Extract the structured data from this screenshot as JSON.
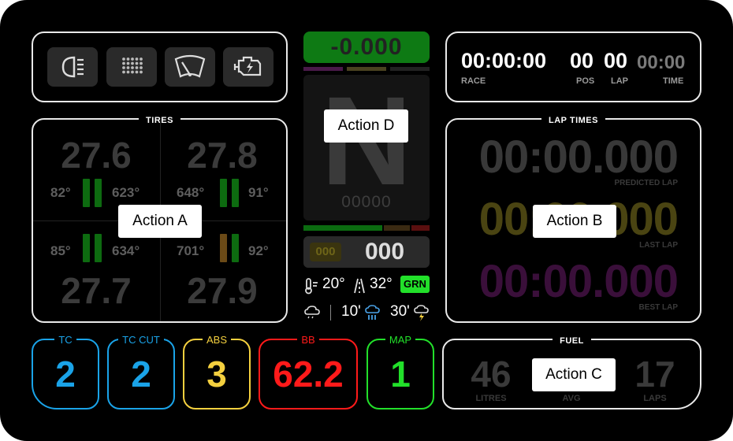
{
  "tires": {
    "title": "TIRES",
    "fl": {
      "pressure": "27.6",
      "inner": "82°",
      "outer": "623°"
    },
    "fr": {
      "pressure": "27.8",
      "inner": "648°",
      "outer": "91°"
    },
    "rl": {
      "pressure": "27.7",
      "inner": "85°",
      "outer": "634°"
    },
    "rr": {
      "pressure": "27.9",
      "inner": "701°",
      "outer": "92°"
    }
  },
  "center": {
    "delta": "-0.000",
    "gear": "N",
    "rpm": "00000",
    "limit_badge": "000",
    "speed": "000",
    "air_temp": "20°",
    "track_temp": "32°",
    "flag": "GRN",
    "forecast_10": "10'",
    "forecast_30": "30'"
  },
  "race_info": {
    "race_time": "00:00:00",
    "race_label": "RACE",
    "pos": "00",
    "pos_label": "POS",
    "lap": "00",
    "lap_label": "LAP",
    "time": "00:00",
    "time_label": "TIME"
  },
  "lap_times": {
    "title": "LAP TIMES",
    "predicted": "00:00.000",
    "predicted_label": "PREDICTED LAP",
    "last": "00:00.000",
    "last_label": "LAST LAP",
    "best": "00:00.000",
    "best_label": "BEST LAP"
  },
  "settings": [
    {
      "label": "TC",
      "value": "2"
    },
    {
      "label": "TC CUT",
      "value": "2"
    },
    {
      "label": "ABS",
      "value": "3"
    },
    {
      "label": "BB",
      "value": "62.2"
    },
    {
      "label": "MAP",
      "value": "1"
    }
  ],
  "fuel": {
    "title": "FUEL",
    "litres": "46",
    "litres_label": "LITRES",
    "avg_label": "AVG",
    "laps": "17",
    "laps_label": "LAPS"
  },
  "actions": {
    "a": "Action A",
    "b": "Action B",
    "c": "Action C",
    "d": "Action D"
  },
  "icons": [
    "headlight-icon",
    "grid-dots-icon",
    "wiper-icon",
    "engine-warning-icon"
  ],
  "colors": {
    "tc": "#1aa3e8",
    "abs": "#f4d03f",
    "bb": "#ff1a1a",
    "map": "#22e02a",
    "delta_bg": "#0e7a14",
    "flag_green": "#22e02a",
    "last_lap": "#4a4412",
    "best_lap": "#3a0f3a"
  }
}
